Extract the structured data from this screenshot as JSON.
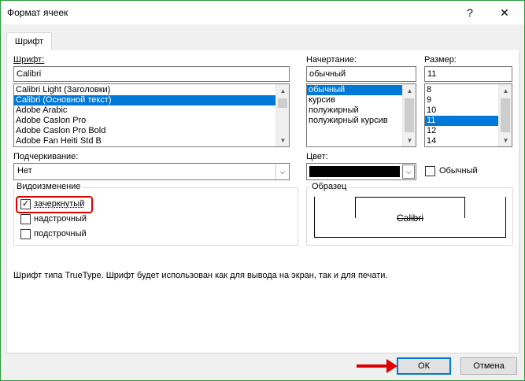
{
  "window": {
    "title": "Формат ячеек",
    "help_glyph": "?",
    "close_glyph": "✕"
  },
  "tabs": [
    {
      "label": "Шрифт"
    }
  ],
  "font": {
    "label": "Шрифт:",
    "value": "Calibri",
    "items": [
      "Calibri Light (Заголовки)",
      "Calibri (Основной текст)",
      "Adobe Arabic",
      "Adobe Caslon Pro",
      "Adobe Caslon Pro Bold",
      "Adobe Fan Heiti Std B"
    ],
    "selected_index": 1
  },
  "style": {
    "label": "Начертание:",
    "value": "обычный",
    "items": [
      "обычный",
      "курсив",
      "полужирный",
      "полужирный курсив"
    ],
    "selected_index": 0
  },
  "size": {
    "label": "Размер:",
    "value": "11",
    "items": [
      "8",
      "9",
      "10",
      "11",
      "12",
      "14"
    ],
    "selected_index": 3
  },
  "underline": {
    "label": "Подчеркивание:",
    "value": "Нет"
  },
  "color": {
    "label": "Цвет:",
    "swatch": "#000000",
    "normal_label": "Обычный",
    "normal_checked": false
  },
  "effects": {
    "title": "Видоизменение",
    "items": [
      {
        "label": "зачеркнутый",
        "checked": true
      },
      {
        "label": "надстрочный",
        "checked": false
      },
      {
        "label": "подстрочный",
        "checked": false
      }
    ]
  },
  "preview": {
    "title": "Образец",
    "sample": "Calibri"
  },
  "info_text": "Шрифт типа TrueType. Шрифт будет использован как для вывода на экран, так и для печати.",
  "buttons": {
    "ok": "ОК",
    "cancel": "Отмена"
  },
  "colors": {
    "accent": "#0078d7",
    "highlight": "#e00000",
    "frame": "#2b9b3a"
  }
}
